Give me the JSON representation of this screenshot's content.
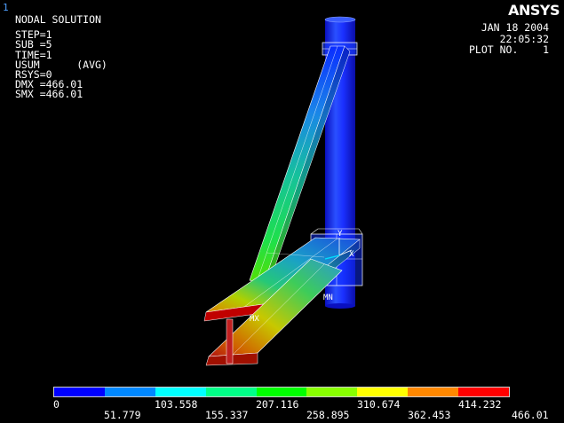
{
  "window_number": "1",
  "logo": "ANSYS",
  "solution_info": [
    "NODAL SOLUTION",
    "STEP=1",
    "SUB =5",
    "TIME=1",
    "USUM      (AVG)",
    "RSYS=0",
    "DMX =466.01",
    "SMX =466.01"
  ],
  "stamp": {
    "date": "JAN 18 2004",
    "time": "22:05:32",
    "plot": "PLOT NO.    1"
  },
  "markers": {
    "min": "MN",
    "max": "MX",
    "y_axis": "Y",
    "x_axis": "X"
  },
  "legend": {
    "colors": [
      "#0000ff",
      "#0088ff",
      "#00ffff",
      "#00ff88",
      "#00ff00",
      "#88ff00",
      "#ffff00",
      "#ff8800",
      "#ff0000"
    ],
    "upper_labels": [
      "0",
      "103.558",
      "207.116",
      "310.674",
      "414.232"
    ],
    "lower_labels": [
      "51.779",
      "155.337",
      "258.895",
      "362.453",
      "466.01"
    ]
  }
}
